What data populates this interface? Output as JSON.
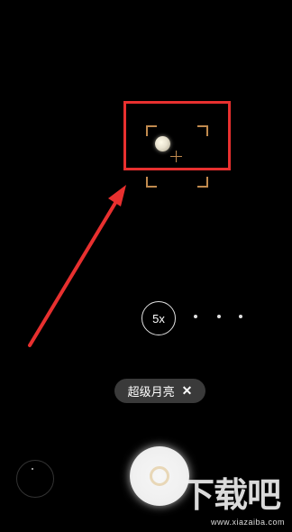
{
  "zoom": {
    "label": "5x",
    "dot_count": 3
  },
  "mode_chip": {
    "label": "超级月亮",
    "close_glyph": "✕"
  },
  "watermark": {
    "title": "下载吧",
    "url": "www.xiazaiba.com"
  },
  "colors": {
    "highlight": "#e8302f",
    "focus": "#c08a4e",
    "chip_bg": "#3a3a3a"
  },
  "icons": {
    "crosshair": "crosshair-icon",
    "close": "close-icon"
  }
}
